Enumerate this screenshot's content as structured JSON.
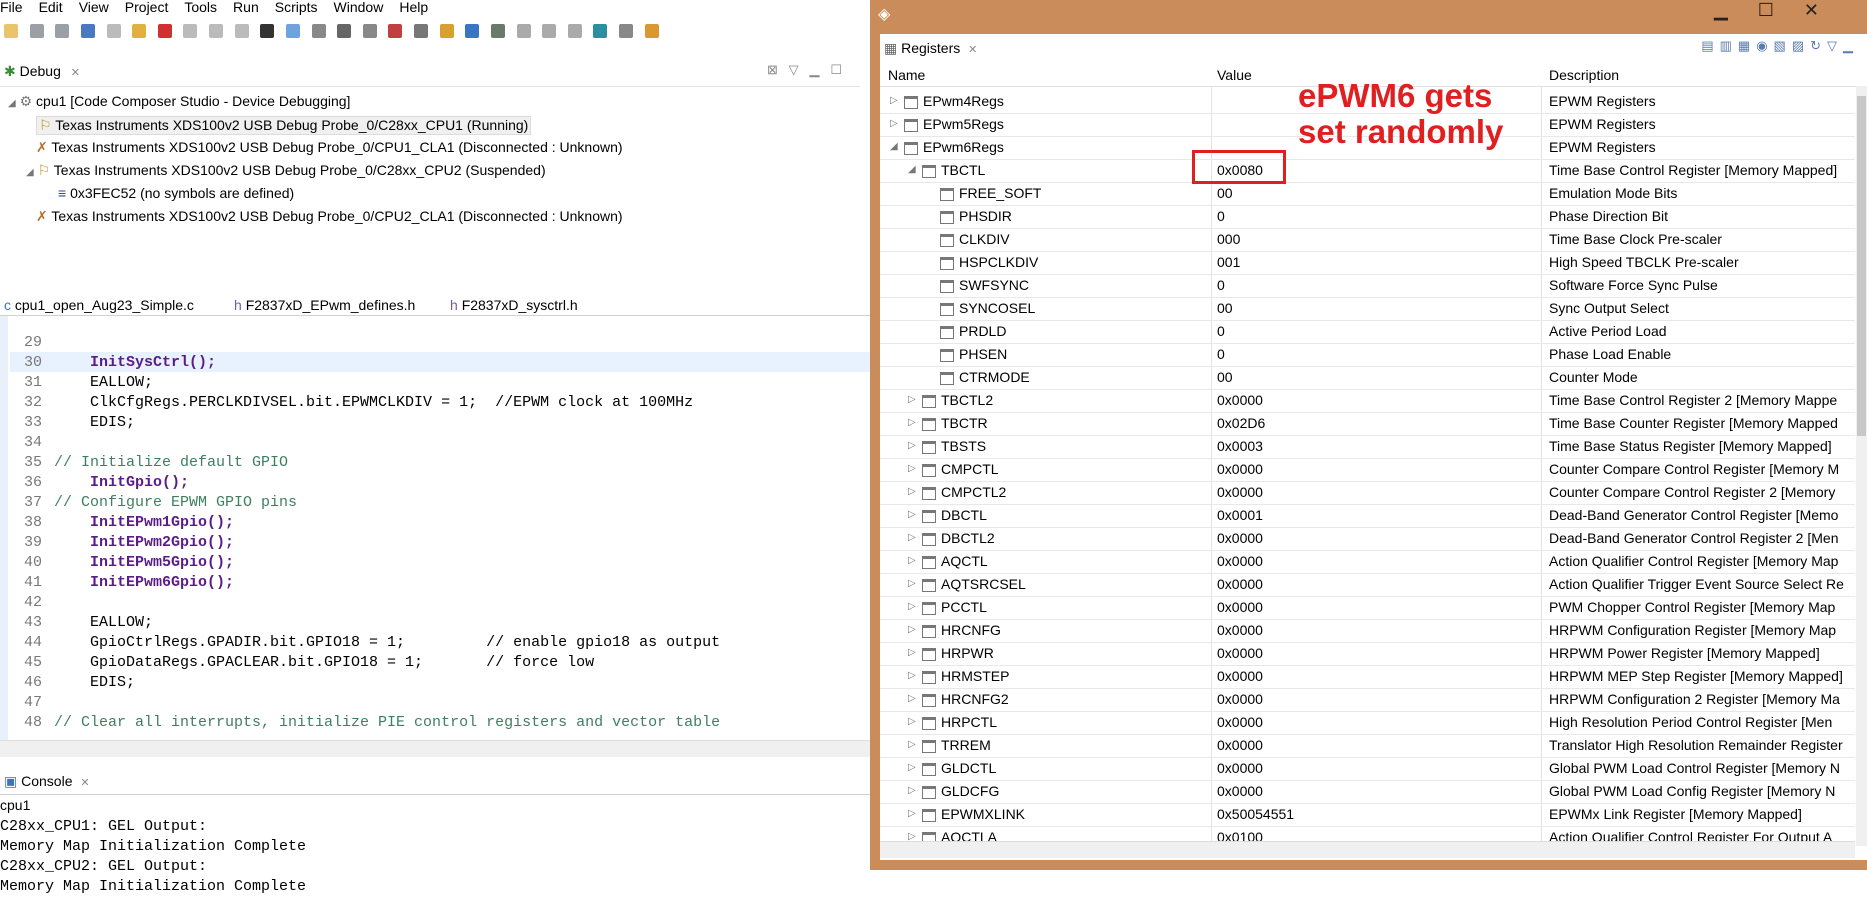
{
  "menu": [
    "File",
    "Edit",
    "View",
    "Project",
    "Tools",
    "Run",
    "Scripts",
    "Window",
    "Help"
  ],
  "debug": {
    "tab": "Debug",
    "root": "cpu1 [Code Composer Studio - Device Debugging]",
    "items": [
      "Texas Instruments XDS100v2 USB Debug Probe_0/C28xx_CPU1 (Running)",
      "Texas Instruments XDS100v2 USB Debug Probe_0/CPU1_CLA1 (Disconnected : Unknown)",
      "Texas Instruments XDS100v2 USB Debug Probe_0/C28xx_CPU2 (Suspended)",
      "0x3FEC52  (no symbols are defined)",
      "Texas Instruments XDS100v2 USB Debug Probe_0/CPU2_CLA1 (Disconnected : Unknown)"
    ]
  },
  "editor": {
    "tabs": [
      "cpu1_open_Aug23_Simple.c",
      "F2837xD_EPwm_defines.h",
      "F2837xD_sysctrl.h"
    ],
    "lines": [
      {
        "n": "29",
        "t": ""
      },
      {
        "n": "30",
        "t": "    InitSysCtrl();"
      },
      {
        "n": "31",
        "t": "    EALLOW;"
      },
      {
        "n": "32",
        "t": "    ClkCfgRegs.PERCLKDIVSEL.bit.EPWMCLKDIV = 1;  //EPWM clock at 100MHz"
      },
      {
        "n": "33",
        "t": "    EDIS;"
      },
      {
        "n": "34",
        "t": ""
      },
      {
        "n": "35",
        "t": "// Initialize default GPIO"
      },
      {
        "n": "36",
        "t": "    InitGpio();"
      },
      {
        "n": "37",
        "t": "// Configure EPWM GPIO pins"
      },
      {
        "n": "38",
        "t": "    InitEPwm1Gpio();"
      },
      {
        "n": "39",
        "t": "    InitEPwm2Gpio();"
      },
      {
        "n": "40",
        "t": "    InitEPwm5Gpio();"
      },
      {
        "n": "41",
        "t": "    InitEPwm6Gpio();"
      },
      {
        "n": "42",
        "t": ""
      },
      {
        "n": "43",
        "t": "    EALLOW;"
      },
      {
        "n": "44",
        "t": "    GpioCtrlRegs.GPADIR.bit.GPIO18 = 1;         // enable gpio18 as output"
      },
      {
        "n": "45",
        "t": "    GpioDataRegs.GPACLEAR.bit.GPIO18 = 1;       // force low"
      },
      {
        "n": "46",
        "t": "    EDIS;"
      },
      {
        "n": "47",
        "t": ""
      },
      {
        "n": "48",
        "t": "// Clear all interrupts, initialize PIE control registers and vector table"
      }
    ]
  },
  "console": {
    "tab": "Console",
    "context": "cpu1",
    "lines": [
      "C28xx_CPU1: GEL Output:",
      "Memory Map Initialization Complete",
      "C28xx_CPU2: GEL Output:",
      "Memory Map Initialization Complete"
    ]
  },
  "registers": {
    "tab": "Registers",
    "columns": [
      "Name",
      "Value",
      "Description"
    ],
    "rows": [
      {
        "name": "EPwm4Regs",
        "value": "",
        "desc": "EPWM Registers",
        "level": 0,
        "exp": "closed"
      },
      {
        "name": "EPwm5Regs",
        "value": "",
        "desc": "EPWM Registers",
        "level": 0,
        "exp": "closed"
      },
      {
        "name": "EPwm6Regs",
        "value": "",
        "desc": "EPWM Registers",
        "level": 0,
        "exp": "open"
      },
      {
        "name": "TBCTL",
        "value": "0x0080",
        "desc": "Time Base Control Register [Memory Mapped]",
        "level": 1,
        "exp": "open"
      },
      {
        "name": "FREE_SOFT",
        "value": "00",
        "desc": "Emulation Mode Bits",
        "level": 2,
        "exp": "none"
      },
      {
        "name": "PHSDIR",
        "value": "0",
        "desc": "Phase Direction Bit",
        "level": 2,
        "exp": "none"
      },
      {
        "name": "CLKDIV",
        "value": "000",
        "desc": "Time Base Clock Pre-scaler",
        "level": 2,
        "exp": "none"
      },
      {
        "name": "HSPCLKDIV",
        "value": "001",
        "desc": "High Speed TBCLK Pre-scaler",
        "level": 2,
        "exp": "none"
      },
      {
        "name": "SWFSYNC",
        "value": "0",
        "desc": "Software Force Sync Pulse",
        "level": 2,
        "exp": "none"
      },
      {
        "name": "SYNCOSEL",
        "value": "00",
        "desc": "Sync Output Select",
        "level": 2,
        "exp": "none"
      },
      {
        "name": "PRDLD",
        "value": "0",
        "desc": "Active Period Load",
        "level": 2,
        "exp": "none"
      },
      {
        "name": "PHSEN",
        "value": "0",
        "desc": "Phase Load Enable",
        "level": 2,
        "exp": "none"
      },
      {
        "name": "CTRMODE",
        "value": "00",
        "desc": "Counter Mode",
        "level": 2,
        "exp": "none"
      },
      {
        "name": "TBCTL2",
        "value": "0x0000",
        "desc": "Time Base Control Register 2 [Memory Mappe",
        "level": 1,
        "exp": "closed"
      },
      {
        "name": "TBCTR",
        "value": "0x02D6",
        "desc": "Time Base Counter Register [Memory Mapped",
        "level": 1,
        "exp": "closed"
      },
      {
        "name": "TBSTS",
        "value": "0x0003",
        "desc": "Time Base Status Register [Memory Mapped]",
        "level": 1,
        "exp": "closed"
      },
      {
        "name": "CMPCTL",
        "value": "0x0000",
        "desc": "Counter Compare Control Register [Memory M",
        "level": 1,
        "exp": "closed"
      },
      {
        "name": "CMPCTL2",
        "value": "0x0000",
        "desc": "Counter Compare Control Register 2 [Memory",
        "level": 1,
        "exp": "closed"
      },
      {
        "name": "DBCTL",
        "value": "0x0001",
        "desc": "Dead-Band Generator Control Register [Memo",
        "level": 1,
        "exp": "closed"
      },
      {
        "name": "DBCTL2",
        "value": "0x0000",
        "desc": "Dead-Band Generator Control Register 2 [Men",
        "level": 1,
        "exp": "closed"
      },
      {
        "name": "AQCTL",
        "value": "0x0000",
        "desc": "Action Qualifier Control Register [Memory Map",
        "level": 1,
        "exp": "closed"
      },
      {
        "name": "AQTSRCSEL",
        "value": "0x0000",
        "desc": "Action Qualifier Trigger Event Source Select Re",
        "level": 1,
        "exp": "closed"
      },
      {
        "name": "PCCTL",
        "value": "0x0000",
        "desc": "PWM Chopper Control Register [Memory Map",
        "level": 1,
        "exp": "closed"
      },
      {
        "name": "HRCNFG",
        "value": "0x0000",
        "desc": "HRPWM Configuration Register [Memory Map",
        "level": 1,
        "exp": "closed"
      },
      {
        "name": "HRPWR",
        "value": "0x0000",
        "desc": "HRPWM Power Register [Memory Mapped]",
        "level": 1,
        "exp": "closed"
      },
      {
        "name": "HRMSTEP",
        "value": "0x0000",
        "desc": "HRPWM MEP Step Register [Memory Mapped]",
        "level": 1,
        "exp": "closed"
      },
      {
        "name": "HRCNFG2",
        "value": "0x0000",
        "desc": "HRPWM Configuration 2 Register [Memory Ma",
        "level": 1,
        "exp": "closed"
      },
      {
        "name": "HRPCTL",
        "value": "0x0000",
        "desc": "High Resolution Period Control Register  [Men",
        "level": 1,
        "exp": "closed"
      },
      {
        "name": "TRREM",
        "value": "0x0000",
        "desc": "Translator High Resolution Remainder Register",
        "level": 1,
        "exp": "closed"
      },
      {
        "name": "GLDCTL",
        "value": "0x0000",
        "desc": "Global PWM Load Control Register [Memory N",
        "level": 1,
        "exp": "closed"
      },
      {
        "name": "GLDCFG",
        "value": "0x0000",
        "desc": "Global PWM Load Config Register  [Memory N",
        "level": 1,
        "exp": "closed"
      },
      {
        "name": "EPWMXLINK",
        "value": "0x50054551",
        "desc": "EPWMx Link Register [Memory Mapped]",
        "level": 1,
        "exp": "closed"
      },
      {
        "name": "AQCTLA",
        "value": "0x0100",
        "desc": "Action Qualifier Control Register For Output A",
        "level": 1,
        "exp": "closed"
      }
    ]
  },
  "annotation": {
    "line1": "ePWM6 gets",
    "line2": "set randomly",
    "color": "#e02020"
  },
  "colors": {
    "window_frame": "#c98c5a",
    "highlight": "#e02020"
  }
}
